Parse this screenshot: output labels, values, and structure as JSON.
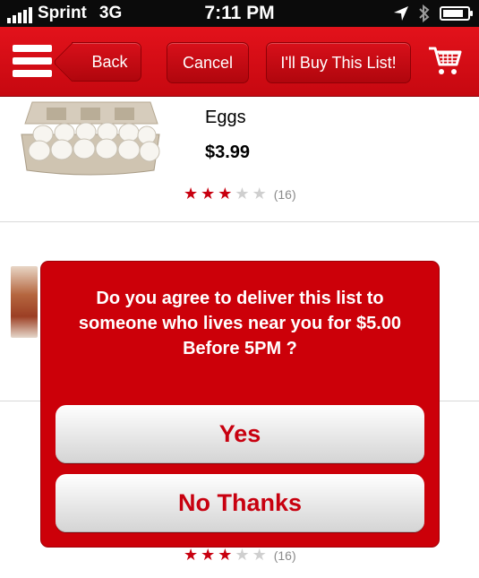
{
  "status_bar": {
    "carrier": "Sprint",
    "network": "3G",
    "time": "7:11 PM",
    "battery_level": 0.85
  },
  "nav": {
    "back_label": "Back",
    "cancel_label": "Cancel",
    "buy_label": "I'll Buy This List!"
  },
  "items": [
    {
      "name": "Eggs",
      "price": "$3.99",
      "rating": 3,
      "rating_max": 5,
      "review_count": "(16)"
    },
    {
      "rating": 3,
      "rating_max": 5,
      "review_count": "(16)"
    }
  ],
  "dialog": {
    "message": "Do you agree to deliver this list to someone who lives near you for $5.00 Before 5PM ?",
    "yes_label": "Yes",
    "no_label": "No Thanks"
  },
  "colors": {
    "brand_red": "#cc0009",
    "star_on": "#c8000f",
    "star_off": "#cfcfcf"
  },
  "icons": {
    "menu": "hamburger-menu-icon",
    "cart": "shopping-cart-icon",
    "location": "location-arrow-icon",
    "bluetooth": "bluetooth-icon",
    "battery": "battery-icon",
    "signal": "signal-bars-icon"
  }
}
